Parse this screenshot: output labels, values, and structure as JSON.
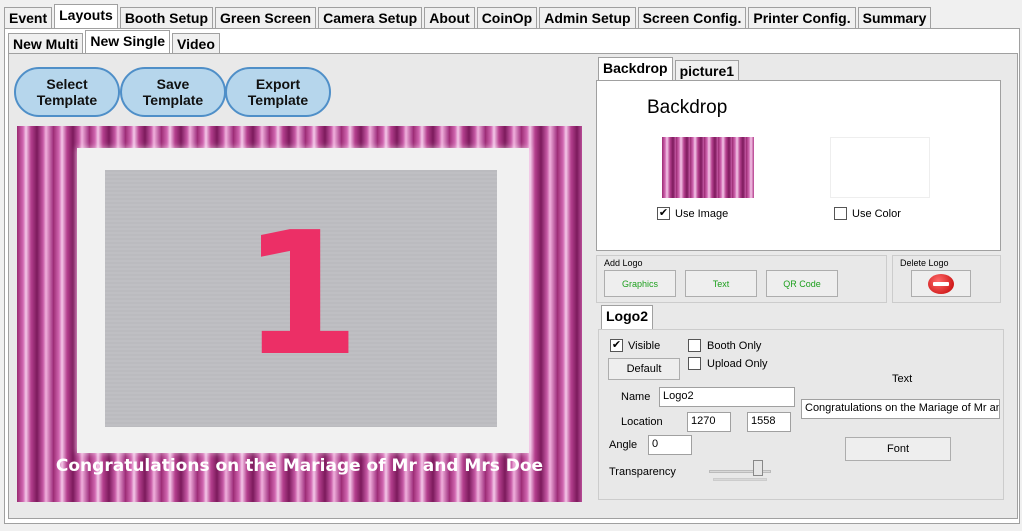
{
  "main_tabs": [
    "Event",
    "Layouts",
    "Booth Setup",
    "Green Screen",
    "Camera Setup",
    "About",
    "CoinOp",
    "Admin Setup",
    "Screen Config.",
    "Printer Config.",
    "Summary"
  ],
  "sub_tabs": [
    "New Multi",
    "New Single",
    "Video"
  ],
  "template_buttons": {
    "select": "Select Template",
    "save": "Save Template",
    "export": "Export Template"
  },
  "preview": {
    "numeral": "1",
    "caption": "Congratulations on the Mariage of Mr and Mrs Doe"
  },
  "backdrop_tabs": [
    "Backdrop",
    "picture1"
  ],
  "backdrop": {
    "title": "Backdrop",
    "use_image": "Use Image",
    "use_image_checked": true,
    "use_color": "Use Color",
    "use_color_checked": false
  },
  "add_logo": {
    "label": "Add Logo",
    "graphics": "Graphics",
    "text": "Text",
    "qr": "QR Code"
  },
  "delete_logo": {
    "label": "Delete Logo"
  },
  "logo_tab": "Logo2",
  "logo": {
    "visible": "Visible",
    "visible_checked": true,
    "booth_only": "Booth Only",
    "upload_only": "Upload Only",
    "default_btn": "Default",
    "name_label": "Name",
    "name_value": "Logo2",
    "location_label": "Location",
    "loc_x": "1270",
    "loc_y": "1558",
    "angle_label": "Angle",
    "angle_value": "0",
    "transparency_label": "Transparency",
    "transparency": 0.85,
    "text_label": "Text",
    "text_value": "Congratulations on the Mariage of Mr and Mrs Doe",
    "font_btn": "Font"
  },
  "colors": {
    "accent_green": "#1ea01e",
    "numeral": "#ec2f66",
    "button_fill": "#b6d6ec",
    "button_border": "#4f8fc8"
  }
}
